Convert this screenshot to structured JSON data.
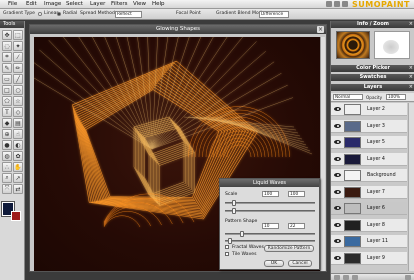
{
  "menu": {
    "file": "File",
    "edit": "Edit",
    "image": "Image",
    "select": "Select",
    "layer": "Layer",
    "filters": "Filters",
    "view": "View",
    "help": "Help",
    "logo": "SUMOPAINT"
  },
  "options": {
    "gradient_type_label": "Gradient Type",
    "linear_label": "Linear",
    "radial_label": "Radial",
    "spread_method_label": "Spread Method",
    "spread_method_value": "Reflect",
    "focal_point_label": "Focal Point",
    "blend_mode_label": "Gradient Blend Mode",
    "blend_mode_value": "Difference"
  },
  "tools_panel": {
    "title": "Tools"
  },
  "canvas": {
    "title": "Glowing Shapes"
  },
  "dialog": {
    "title": "Liquid Waves",
    "scale_label": "Scale",
    "scale_x": "100",
    "scale_y": "100",
    "pattern_shape_label": "Pattern Shape",
    "pattern_a": "10",
    "pattern_b": "22",
    "fractal_waves_label": "Fractal Waves",
    "tile_waves_label": "Tile Waves",
    "randomize_label": "Randomize Pattern",
    "ok_label": "OK",
    "cancel_label": "Cancel"
  },
  "panels": {
    "info_zoom": "Info / Zoom",
    "color_picker": "Color Picker",
    "swatches": "Swatches",
    "layers": "Layers",
    "blend_mode": "Normal",
    "opacity_label": "Opacity",
    "opacity_value": "100%"
  },
  "layers": [
    {
      "name": "Layer 2",
      "thumb": "#f0f0f0"
    },
    {
      "name": "Layer 3",
      "thumb": "#5a6a8a"
    },
    {
      "name": "Layer 5",
      "thumb": "#2a2a6a"
    },
    {
      "name": "Layer 4",
      "thumb": "#1a1a3a"
    },
    {
      "name": "Background",
      "thumb": "#f4f4f4"
    },
    {
      "name": "Layer 7",
      "thumb": "#3a1a10"
    },
    {
      "name": "Layer 6",
      "thumb": "#bdbdbd"
    },
    {
      "name": "Layer 8",
      "thumb": "#202020"
    },
    {
      "name": "Layer 11",
      "thumb": "#3a6aa0"
    },
    {
      "name": "Layer 9",
      "thumb": "#2a2a2a"
    }
  ],
  "colors": {
    "accent": "#e6a800",
    "foreground": "#0f1a3a",
    "background_color": "#9e1b1b",
    "glow": "#ff9a2a"
  }
}
